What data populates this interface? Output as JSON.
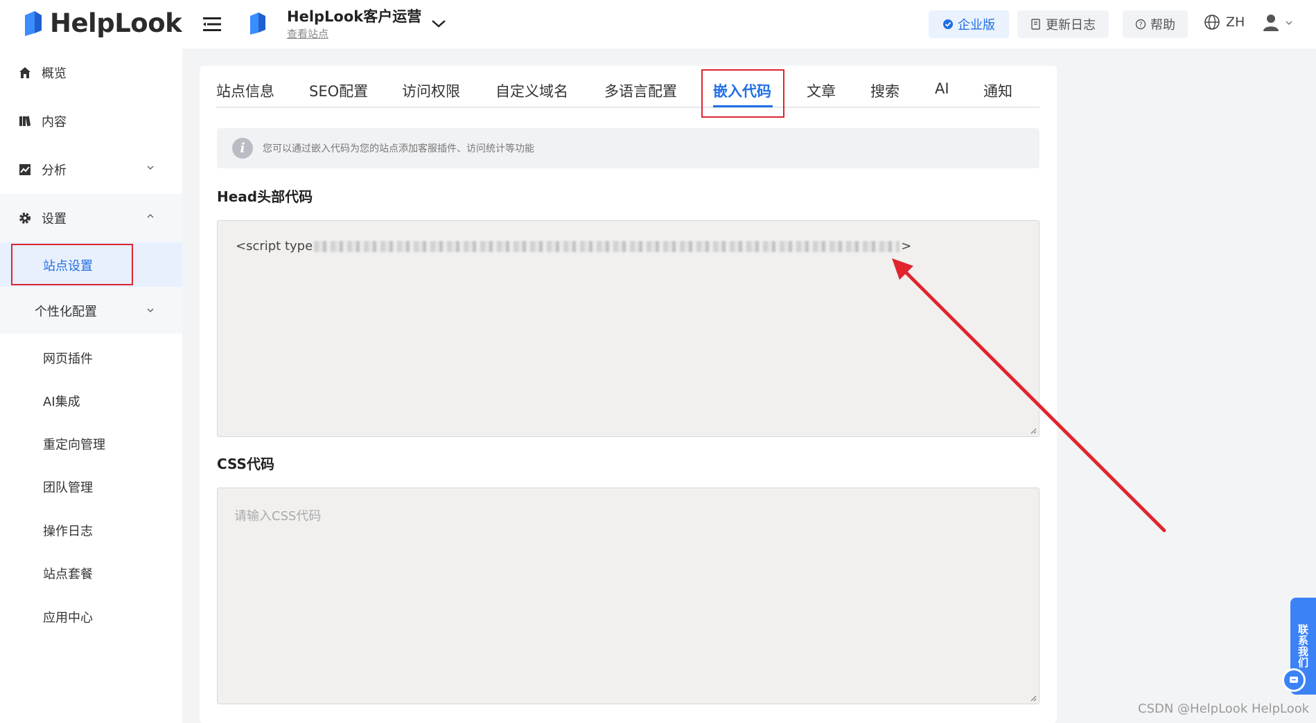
{
  "brand": {
    "name": "HelpLook",
    "primary": "#1f6fe5",
    "highlight": "#d9262e"
  },
  "sidebar": {
    "items": [
      {
        "label": "概览",
        "icon": "home-icon"
      },
      {
        "label": "内容",
        "icon": "book-icon"
      },
      {
        "label": "分析",
        "icon": "chart-icon"
      },
      {
        "label": "设置",
        "icon": "gear-icon"
      }
    ],
    "active_sub": "站点设置",
    "personalize": "个性化配置",
    "subitems": [
      "网页插件",
      "AI集成",
      "重定向管理",
      "团队管理",
      "操作日志",
      "站点套餐",
      "应用中心"
    ]
  },
  "header": {
    "site_title": "HelpLook客户运营",
    "site_link": "查看站点",
    "enterprise": "企业版",
    "changelog": "更新日志",
    "help": "帮助",
    "lang": "ZH"
  },
  "tabs": [
    "站点信息",
    "SEO配置",
    "访问权限",
    "自定义域名",
    "多语言配置",
    "嵌入代码",
    "文章",
    "搜索",
    "AI",
    "通知"
  ],
  "active_tab": "嵌入代码",
  "notice": "您可以通过嵌入代码为您的站点添加客服插件、访问统计等功能",
  "head_section": {
    "label": "Head头部代码",
    "code_start": "<script type",
    "code_end": ">"
  },
  "css_section": {
    "label": "CSS代码",
    "placeholder": "请输入CSS代码"
  },
  "feedback": "联系我们",
  "watermark": "CSDN @HelpLook HelpLook"
}
